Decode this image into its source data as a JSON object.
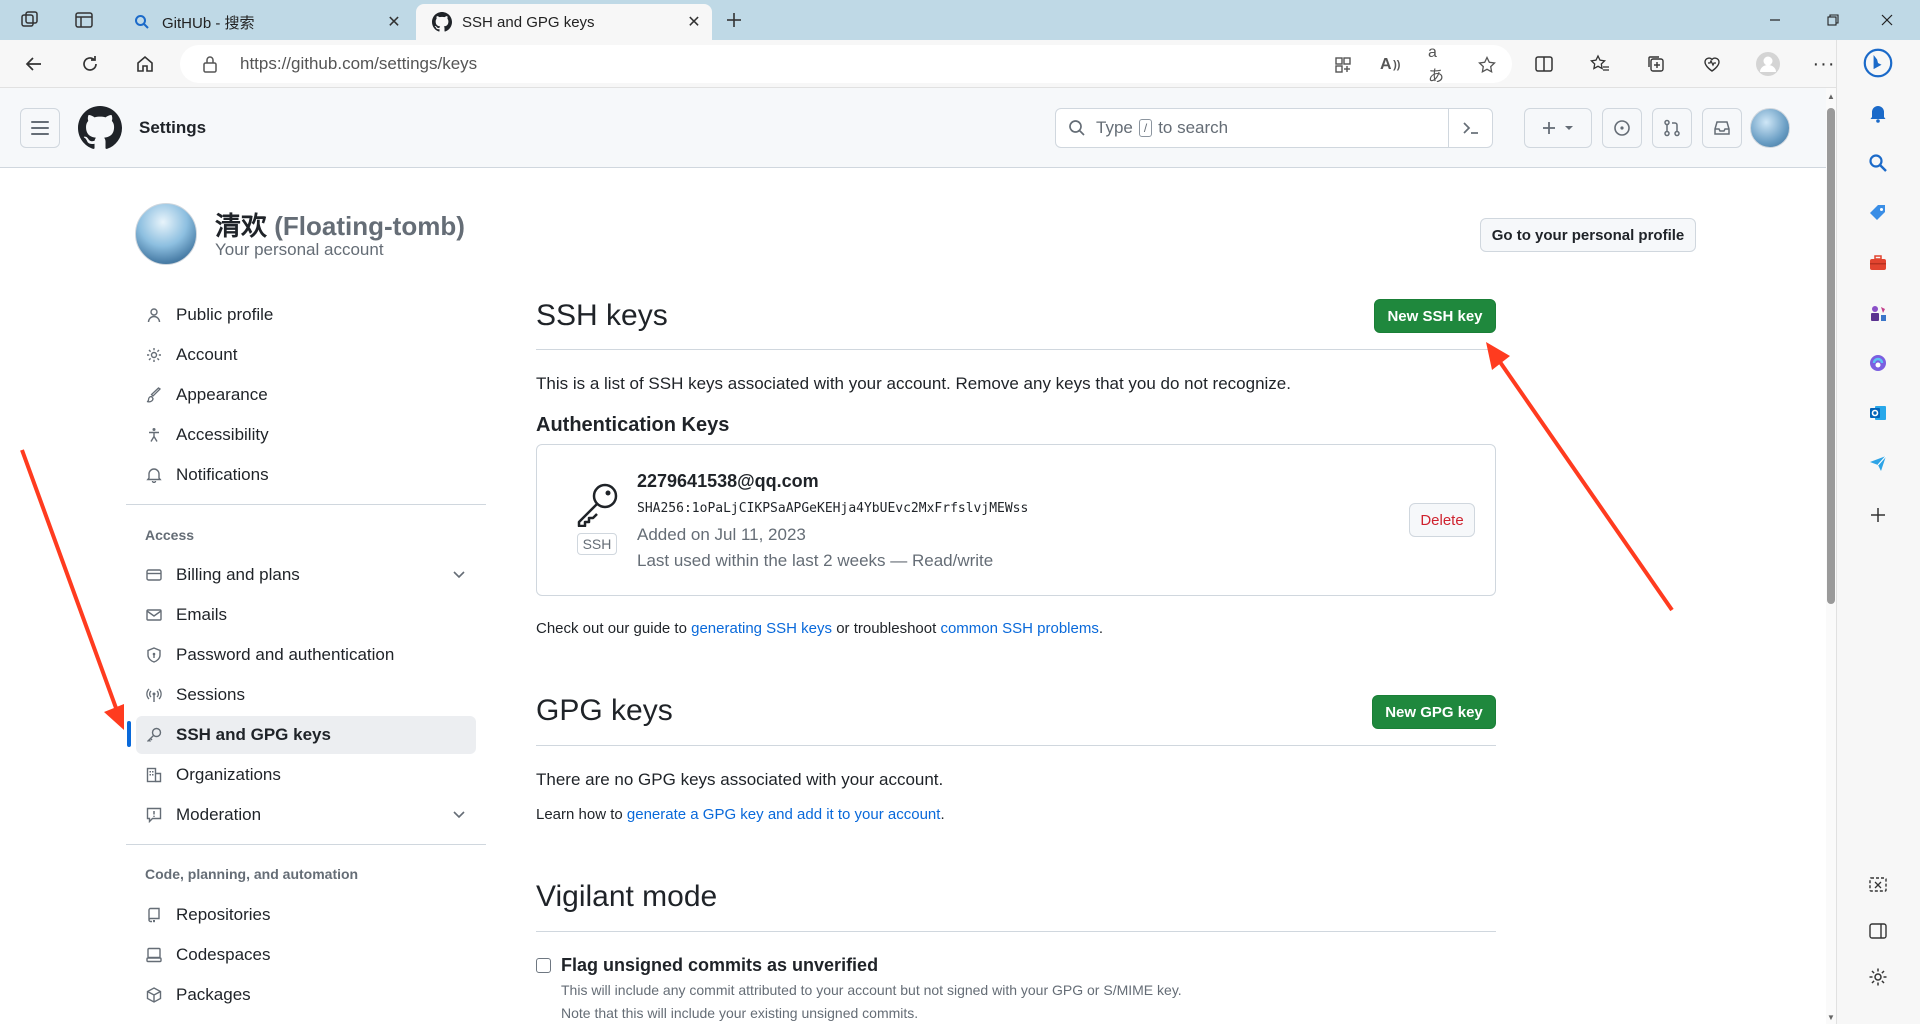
{
  "browser": {
    "tabs": [
      {
        "label": "GitHUb - 搜索",
        "active": false
      },
      {
        "label": "SSH and GPG keys",
        "active": true
      }
    ],
    "new_tab_icon": "plus-icon",
    "url": "https://github.com/settings/keys",
    "window_controls": [
      "minimize-icon",
      "restore-icon",
      "close-icon"
    ]
  },
  "header": {
    "title": "Settings",
    "search_prefix": "Type",
    "search_slash": "/",
    "search_suffix": "to search",
    "create_icon": "plus-icon"
  },
  "profile": {
    "name": "清欢",
    "login": "(Floating-tomb)",
    "subtitle": "Your personal account",
    "go_to_profile": "Go to your personal profile"
  },
  "sidebar": {
    "items": [
      {
        "label": "Public profile",
        "icon": "person-icon"
      },
      {
        "label": "Account",
        "icon": "gear-icon"
      },
      {
        "label": "Appearance",
        "icon": "paintbrush-icon"
      },
      {
        "label": "Accessibility",
        "icon": "accessibility-icon"
      },
      {
        "label": "Notifications",
        "icon": "bell-icon"
      }
    ],
    "access_heading": "Access",
    "access_items": [
      {
        "label": "Billing and plans",
        "icon": "credit-card-icon"
      },
      {
        "label": "Emails",
        "icon": "mail-icon"
      },
      {
        "label": "Password and authentication",
        "icon": "shield-lock-icon"
      },
      {
        "label": "Sessions",
        "icon": "broadcast-icon"
      },
      {
        "label": "SSH and GPG keys",
        "icon": "key-icon",
        "active": true
      },
      {
        "label": "Organizations",
        "icon": "organization-icon"
      },
      {
        "label": "Moderation",
        "icon": "report-icon"
      }
    ],
    "code_heading": "Code, planning, and automation",
    "code_items": [
      {
        "label": "Repositories",
        "icon": "repo-icon"
      },
      {
        "label": "Codespaces",
        "icon": "codespaces-icon"
      },
      {
        "label": "Packages",
        "icon": "package-icon"
      }
    ]
  },
  "ssh": {
    "title": "SSH keys",
    "new_button": "New SSH key",
    "description": "This is a list of SSH keys associated with your account. Remove any keys that you do not recognize.",
    "auth_heading": "Authentication Keys",
    "key": {
      "title": "2279641538@qq.com",
      "fingerprint": "SHA256:1oPaLjCIKPSaAPGeKEHja4YbUEvc2MxFrfslvjMEWss",
      "badge": "SSH",
      "added": "Added on Jul 11, 2023",
      "last_used": "Last used within the last 2 weeks — Read/write",
      "delete": "Delete"
    },
    "guide_prefix": "Check out our guide to",
    "guide_link1": "generating SSH keys",
    "guide_middle": "or troubleshoot",
    "guide_link2": "common SSH problems",
    "guide_suffix": "."
  },
  "gpg": {
    "title": "GPG keys",
    "new_button": "New GPG key",
    "empty": "There are no GPG keys associated with your account.",
    "learn_prefix": "Learn how to",
    "learn_link": "generate a GPG key and add it to your account",
    "learn_suffix": "."
  },
  "vigilant": {
    "title": "Vigilant mode",
    "checkbox_label": "Flag unsigned commits as unverified",
    "checked": false,
    "note1": "This will include any commit attributed to your account but not signed with your GPG or S/MIME key.",
    "note2": "Note that this will include your existing unsigned commits."
  },
  "colors": {
    "primary_button": "#1f883d",
    "link": "#0969da",
    "danger": "#cf222e",
    "active_indicator": "#0969da",
    "annotation_arrow": "#ff3b1f"
  }
}
